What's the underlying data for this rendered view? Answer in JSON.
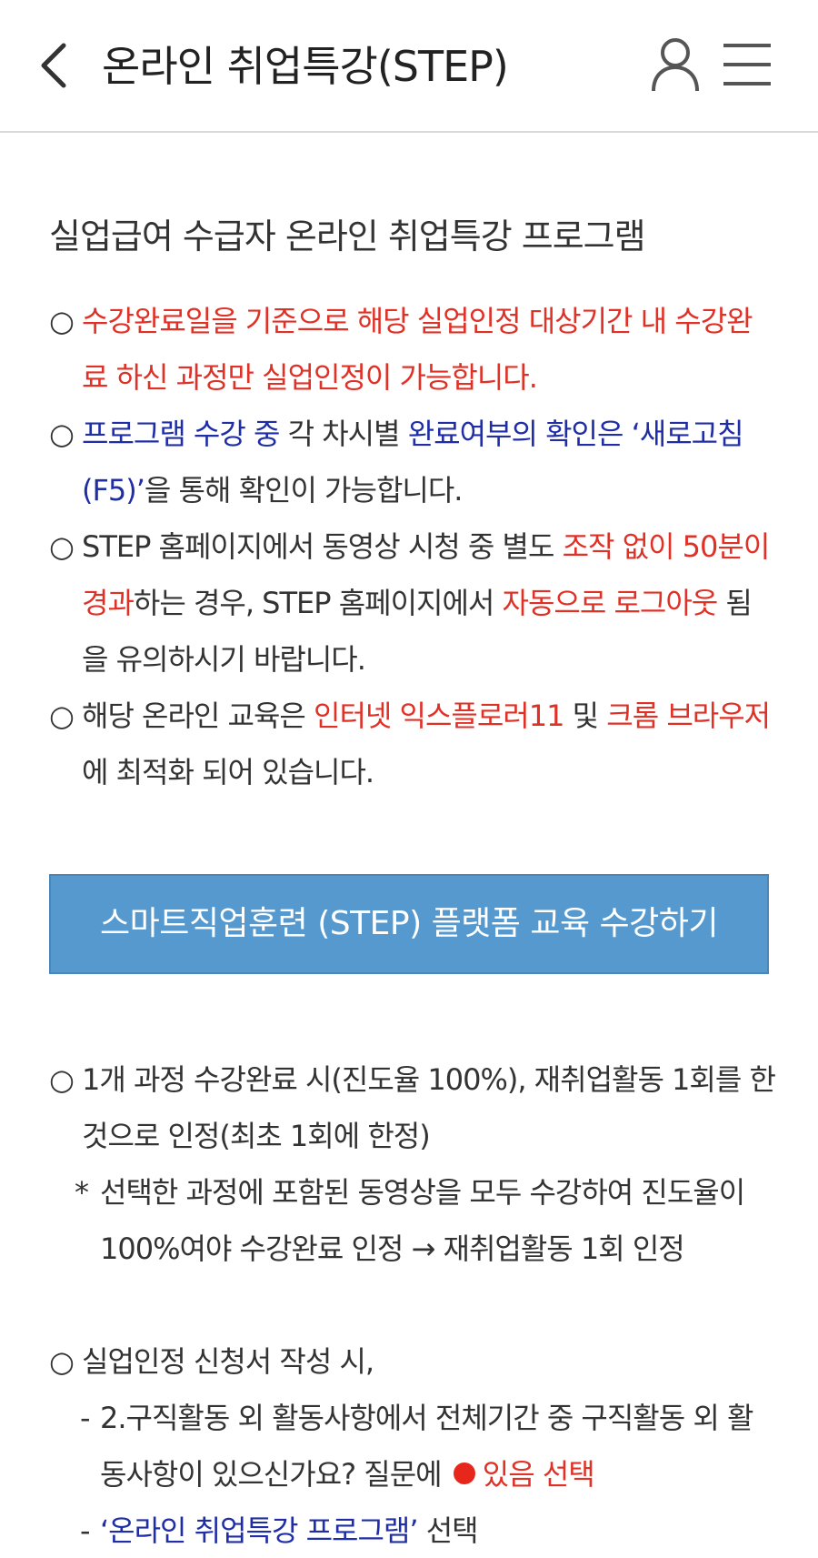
{
  "header": {
    "title": "온라인 취업특강(STEP)",
    "back_icon": "chevron-left-icon",
    "user_icon": "user-icon",
    "menu_icon": "hamburger-menu-icon"
  },
  "main": {
    "section_title": "실업급여 수급자 온라인 취업특강 프로그램",
    "bullet": "○",
    "notes": {
      "n1": {
        "red1": "수강완료일을 기준으로 해당 실업인정 대상기간 내 수강완료 하신 과정만 실업인정이 가능합니다."
      },
      "n2": {
        "blue1": "프로그램 수강 중",
        "text1": " 각 차시별 ",
        "blue2": "완료여부의 확인은 ‘새로고침(F5)’",
        "text2": "을 통해 확인이 가능합니다."
      },
      "n3": {
        "text1": "STEP 홈페이지에서 동영상 시청 중 별도 ",
        "red1": "조작 없이 50분이 경과",
        "text2": "하는 경우, STEP 홈페이지에서 ",
        "red2": "자동으로 로그아웃",
        "text3": " 됨을 유의하시기 바랍니다."
      },
      "n4": {
        "text1": "해당 온라인 교육은 ",
        "red1": "인터넷 익스플로러11",
        "text2": " 및 ",
        "red2": "크롬 브라우저",
        "text3": "에 최적화 되어 있습니다."
      }
    },
    "cta_label": "스마트직업훈련 (STEP) 플랫폼 교육 수강하기",
    "details": {
      "d1": "1개 과정 수강완료 시(진도율 100%), 재취업활동 1회를 한 것으로 인정(최초 1회에 한정)",
      "d1_star_mark": "*",
      "d1_star": "선택한 과정에 포함된 동영상을 모두 수강하여 진도율이 100%여야 수강완료 인정 → 재취업활동 1회 인정",
      "d2": "실업인정 신청서 작성 시,",
      "d2_dash": "-",
      "d2_sub1_text": "2.구직활동 외 활동사항에서 전체기간 중 구직활동 외 활동사항이 있으신가요? 질문에 ",
      "d2_sub1_red": "있음 선택",
      "d2_sub2_blue": "‘온라인 취업특강 프로그램’",
      "d2_sub2_text": " 선택"
    }
  },
  "colors": {
    "accent_red": "#e03127",
    "accent_blue": "#1f2ea6",
    "button_bg": "#5599cf"
  }
}
